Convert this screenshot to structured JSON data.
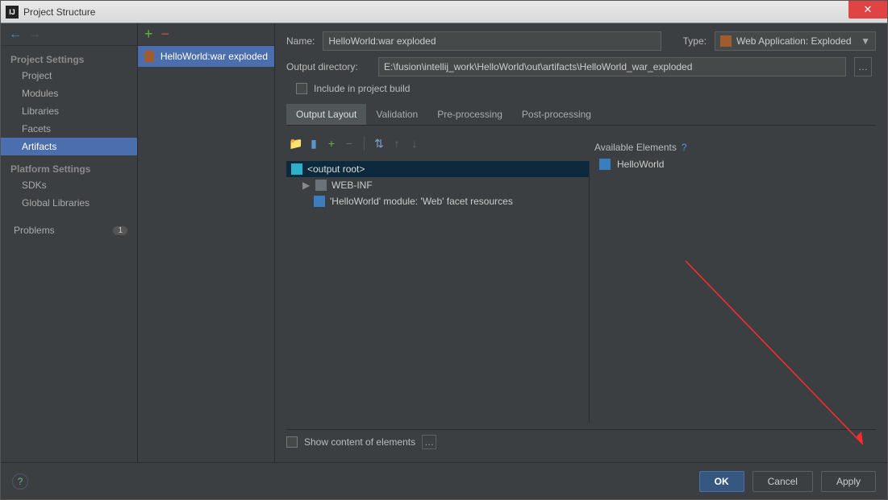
{
  "window": {
    "title": "Project Structure"
  },
  "sidebar": {
    "projectSettingsLabel": "Project Settings",
    "items": [
      "Project",
      "Modules",
      "Libraries",
      "Facets",
      "Artifacts"
    ],
    "platformSettingsLabel": "Platform Settings",
    "platformItems": [
      "SDKs",
      "Global Libraries"
    ],
    "problemsLabel": "Problems",
    "problemsCount": "1"
  },
  "artifactList": {
    "item": "HelloWorld:war exploded"
  },
  "form": {
    "nameLabel": "Name:",
    "nameValue": "HelloWorld:war exploded",
    "typeLabel": "Type:",
    "typeValue": "Web Application: Exploded",
    "outDirLabel": "Output directory:",
    "outDirValue": "E:\\fusion\\intellij_work\\HelloWorld\\out\\artifacts\\HelloWorld_war_exploded",
    "includeBuildLabel": "Include in project build"
  },
  "tabs": [
    "Output Layout",
    "Validation",
    "Pre-processing",
    "Post-processing"
  ],
  "tree": {
    "root": "<output root>",
    "webinf": "WEB-INF",
    "facet": "'HelloWorld' module: 'Web' facet resources"
  },
  "available": {
    "header": "Available Elements",
    "item": "HelloWorld"
  },
  "showContent": "Show content of elements",
  "buttons": {
    "ok": "OK",
    "cancel": "Cancel",
    "apply": "Apply"
  }
}
